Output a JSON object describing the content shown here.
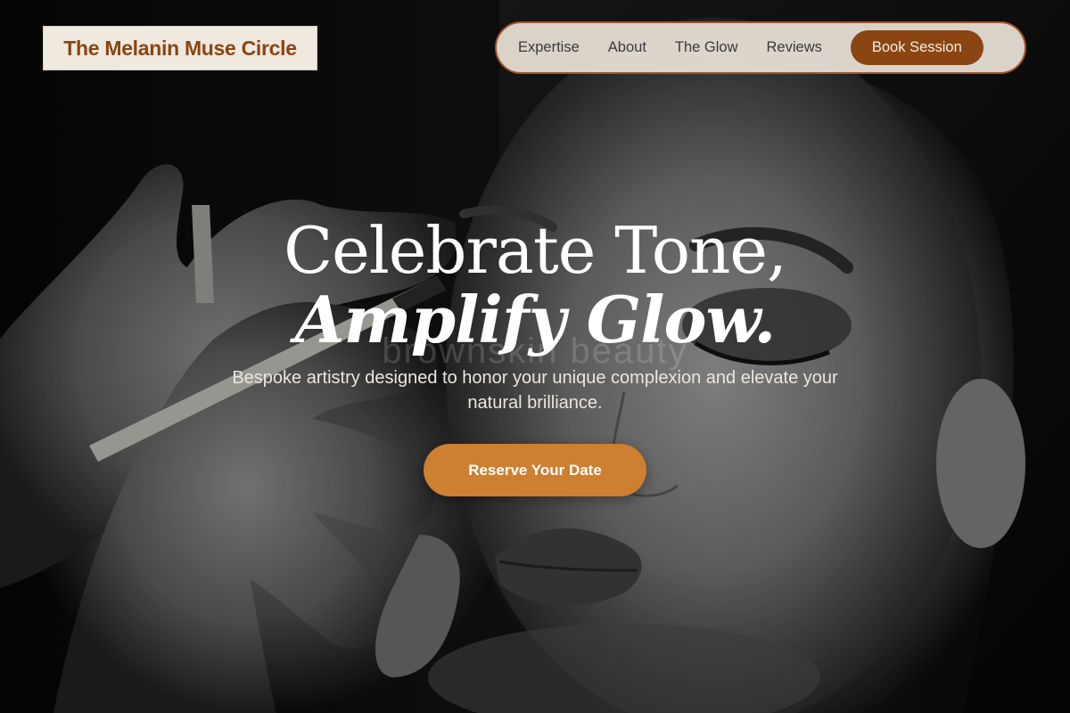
{
  "brand": {
    "name": "The Melanin Muse Circle"
  },
  "nav": {
    "links": [
      "Expertise",
      "About",
      "The Glow",
      "Reviews"
    ],
    "cta_label": "Book Session"
  },
  "hero": {
    "headline_line1": "Celebrate Tone,",
    "headline_line2": "Amplify Glow.",
    "watermark": "brownskin beauty",
    "subheadline": "Bespoke artistry designed to honor your unique complexion and elevate your natural brilliance.",
    "cta_label": "Reserve Your Date"
  },
  "colors": {
    "brand_brown": "#8b4513",
    "accent_copper": "#cd7f32",
    "nav_bg": "#ebe4da",
    "logo_bg": "#efe9df"
  }
}
